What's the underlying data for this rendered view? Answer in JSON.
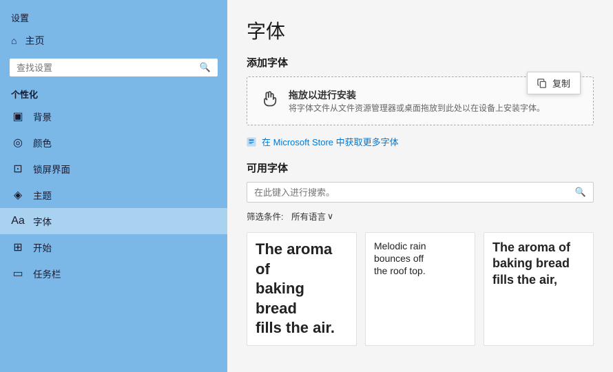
{
  "sidebar": {
    "title": "设置",
    "home": {
      "icon": "⌂",
      "label": "主页"
    },
    "search_placeholder": "查找设置",
    "section_title": "个性化",
    "items": [
      {
        "icon": "▣",
        "label": "背景",
        "id": "background"
      },
      {
        "icon": "◎",
        "label": "颜色",
        "id": "color"
      },
      {
        "icon": "⊡",
        "label": "锁屏界面",
        "id": "lockscreen"
      },
      {
        "icon": "◈",
        "label": "主题",
        "id": "theme"
      },
      {
        "icon": "Aa",
        "label": "字体",
        "id": "font",
        "active": true
      },
      {
        "icon": "⊞",
        "label": "开始",
        "id": "start"
      },
      {
        "icon": "▭",
        "label": "任务栏",
        "id": "taskbar"
      }
    ]
  },
  "main": {
    "title": "字体",
    "add_font": {
      "heading": "添加字体",
      "drop_zone": {
        "icon": "↓",
        "main_text": "拖放以进行安装",
        "sub_text": "将字体文件从文件资源管理器或桌面拖放到此处以在设备上安装字体。"
      },
      "copy_tooltip": "复制",
      "store_link_icon": "🏪",
      "store_link_text": "在 Microsoft Store 中获取更多字体"
    },
    "available_fonts": {
      "heading": "可用字体",
      "search_placeholder": "在此键入进行搜索。",
      "filter_label": "筛选条件:",
      "filter_value": "所有语言",
      "filter_chevron": "∨",
      "font_cards": [
        {
          "lines": [
            "The aroma of",
            "baking bread",
            "fills the air."
          ],
          "size": "large"
        },
        {
          "lines": [
            "Melodic rain",
            "bounces off",
            "the roof top."
          ],
          "size": "medium"
        },
        {
          "lines": [
            "The aroma of",
            "baking bread",
            "fills the air,"
          ],
          "size": "small-bold"
        }
      ]
    }
  }
}
